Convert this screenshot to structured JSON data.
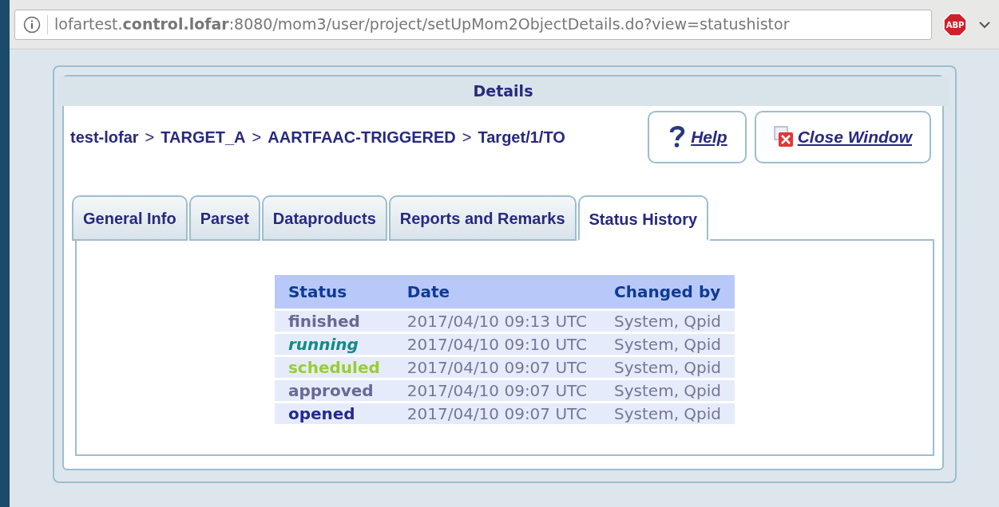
{
  "browser": {
    "address": "lofartest.**control.lofar**:8080/mom3/user/project/setUpMom2ObjectDetails.do?view=statushistor",
    "extension_badge": "ABP"
  },
  "panel": {
    "title": "Details"
  },
  "breadcrumb": [
    "test-lofar",
    "TARGET_A",
    "AARTFAAC-TRIGGERED",
    "Target/1/TO"
  ],
  "breadcrumb_separator": ">",
  "buttons": [
    {
      "kind": "help",
      "label": "Help"
    },
    {
      "kind": "close",
      "label": "Close Window"
    }
  ],
  "tabs": [
    {
      "label": "General Info",
      "selected": false
    },
    {
      "label": "Parset",
      "selected": false
    },
    {
      "label": "Dataproducts",
      "selected": false
    },
    {
      "label": "Reports and Remarks",
      "selected": false
    },
    {
      "label": "Status History",
      "selected": true
    }
  ],
  "table": {
    "columns": [
      "Status",
      "Date",
      "Changed by"
    ],
    "rows": [
      {
        "status": "finished",
        "color": "#666a94",
        "kind": "normal",
        "date": "2017/04/10 09:13 UTC",
        "changed_by": "System, Qpid"
      },
      {
        "status": "running",
        "color": "#138a86",
        "kind": "current",
        "date": "2017/04/10 09:10 UTC",
        "changed_by": "System, Qpid"
      },
      {
        "status": "scheduled",
        "color": "#9acd32",
        "kind": "normal",
        "date": "2017/04/10 09:07 UTC",
        "changed_by": "System, Qpid"
      },
      {
        "status": "approved",
        "color": "#666a94",
        "kind": "normal",
        "date": "2017/04/10 09:07 UTC",
        "changed_by": "System, Qpid"
      },
      {
        "status": "opened",
        "color": "#242a8c",
        "kind": "normal",
        "date": "2017/04/10 09:07 UTC",
        "changed_by": "System, Qpid"
      }
    ]
  }
}
